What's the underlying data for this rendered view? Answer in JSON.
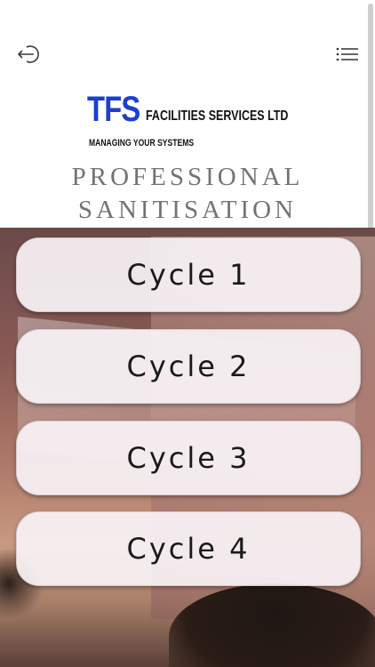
{
  "header": {
    "exit_icon": "exit-icon",
    "menu_icon": "hamburger-menu-icon"
  },
  "logo": {
    "brand": "TFS",
    "company": "FACILITIES SERVICES LTD",
    "tagline": "MANAGING YOUR SYSTEMS",
    "brand_color": "#1b3fd1"
  },
  "title": {
    "line1": "PROFESSIONAL",
    "line2": "SANITISATION",
    "color": "#737373"
  },
  "cycles": [
    {
      "label": "Cycle 1"
    },
    {
      "label": "Cycle 2"
    },
    {
      "label": "Cycle 3"
    },
    {
      "label": "Cycle 4"
    }
  ]
}
